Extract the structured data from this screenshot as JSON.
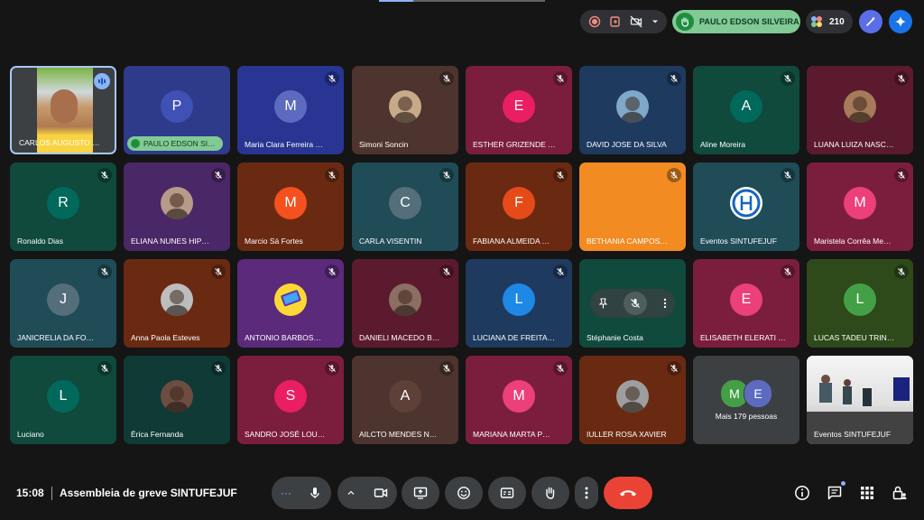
{
  "header": {
    "hand_raised_name": "PAULO EDSON SILVEIRA",
    "participant_count": "210"
  },
  "tiles": [
    {
      "name": "CARLOS AUGUSTO …",
      "initial": "",
      "bg": "#3c4043",
      "avatar_bg": "#bfa35a",
      "photo": true,
      "speaking": true,
      "muted": false
    },
    {
      "name": "PAULO EDSON SI…",
      "initial": "P",
      "bg": "#2e3a8a",
      "avatar_bg": "#3f51b5",
      "hand": true,
      "muted": false
    },
    {
      "name": "Maria Clara Ferreira …",
      "initial": "M",
      "bg": "#283593",
      "avatar_bg": "#5c6bc0",
      "muted": true
    },
    {
      "name": "Simoni Soncin",
      "initial": "",
      "bg": "#4e342e",
      "avatar_bg": "#c8a98a",
      "photo": true,
      "muted": true
    },
    {
      "name": "ESTHER GRIZENDE …",
      "initial": "E",
      "bg": "#7b1e3d",
      "avatar_bg": "#e91e63",
      "muted": true
    },
    {
      "name": "DAVID JOSE DA SILVA",
      "initial": "",
      "bg": "#1e3a5f",
      "avatar_bg": "#7fa8c9",
      "photo": true,
      "muted": true
    },
    {
      "name": "Aline Moreira",
      "initial": "A",
      "bg": "#0f4a3c",
      "avatar_bg": "#00695c",
      "muted": true
    },
    {
      "name": "LUANA LUIZA NASC…",
      "initial": "",
      "bg": "#5c1a2e",
      "avatar_bg": "#a57b5a",
      "photo": true,
      "muted": true
    },
    {
      "name": "Ronaldo Dias",
      "initial": "R",
      "bg": "#0f4a3c",
      "avatar_bg": "#00695c",
      "muted": true
    },
    {
      "name": "ELIANA NUNES HIP…",
      "initial": "",
      "bg": "#4a2766",
      "avatar_bg": "#b89a8a",
      "photo": true,
      "muted": true
    },
    {
      "name": "Marcio Sá Fortes",
      "initial": "M",
      "bg": "#6a2a12",
      "avatar_bg": "#f4511e",
      "muted": true
    },
    {
      "name": "CARLA VISENTIN",
      "initial": "C",
      "bg": "#1f4c57",
      "avatar_bg": "#546e7a",
      "muted": true
    },
    {
      "name": "FABIANA ALMEIDA …",
      "initial": "F",
      "bg": "#6a2a12",
      "avatar_bg": "#e64a19",
      "muted": true
    },
    {
      "name": "BETHANIA CAMPOS…",
      "initial": "",
      "bg": "#f28b22",
      "avatar_bg": "#f28b22",
      "muted": true,
      "noavatar": true
    },
    {
      "name": "Eventos SINTUFEJUF",
      "initial": "",
      "bg": "#1f4c57",
      "avatar_bg": "#ffffff",
      "logo": true,
      "muted": true
    },
    {
      "name": "Maristela Corrêa Me…",
      "initial": "M",
      "bg": "#7b1e3d",
      "avatar_bg": "#ec407a",
      "muted": true
    },
    {
      "name": "JANICRELIA DA FO…",
      "initial": "J",
      "bg": "#1f4c57",
      "avatar_bg": "#546e7a",
      "muted": true
    },
    {
      "name": "Anna Paola Esteves",
      "initial": "",
      "bg": "#6a2a12",
      "avatar_bg": "#bdbdbd",
      "photo": true,
      "muted": true
    },
    {
      "name": "ANTONIO BARBOS…",
      "initial": "",
      "bg": "#5b2a7a",
      "avatar_bg": "#fdd835",
      "phone": true,
      "muted": true
    },
    {
      "name": "DANIELI MACEDO B…",
      "initial": "",
      "bg": "#5c1a2e",
      "avatar_bg": "#8d6e63",
      "photo": true,
      "muted": true
    },
    {
      "name": "LUCIANA DE FREITA…",
      "initial": "L",
      "bg": "#1e3a5f",
      "avatar_bg": "#1e88e5",
      "muted": true
    },
    {
      "name": "Stéphanie Costa",
      "initial": "",
      "bg": "#0f4a3c",
      "avatar_bg": "#0f4a3c",
      "muted": true,
      "hover": true
    },
    {
      "name": "ELISABETH ELERATI …",
      "initial": "E",
      "bg": "#7b1e3d",
      "avatar_bg": "#ec407a",
      "muted": true
    },
    {
      "name": "LUCAS TADEU TRIN…",
      "initial": "L",
      "bg": "#2e4a1a",
      "avatar_bg": "#43a047",
      "muted": true
    },
    {
      "name": "Luciano",
      "initial": "L",
      "bg": "#0f4a3c",
      "avatar_bg": "#00695c",
      "muted": true
    },
    {
      "name": "Érica Fernanda",
      "initial": "",
      "bg": "#0f3a36",
      "avatar_bg": "#6d4c41",
      "photo": true,
      "muted": true
    },
    {
      "name": "SANDRO JOSÉ LOU…",
      "initial": "S",
      "bg": "#7b1e3d",
      "avatar_bg": "#e91e63",
      "muted": true
    },
    {
      "name": "AILCTO MENDES N…",
      "initial": "A",
      "bg": "#4e342e",
      "avatar_bg": "#5d4037",
      "muted": true
    },
    {
      "name": "MARIANA MARTA P…",
      "initial": "M",
      "bg": "#7b1e3d",
      "avatar_bg": "#ec407a",
      "muted": true
    },
    {
      "name": "IULLER ROSA XAVIER",
      "initial": "",
      "bg": "#6a2a12",
      "avatar_bg": "#9e9e9e",
      "photo": true,
      "muted": true
    },
    {
      "name": "Mais 179 pessoas",
      "initial": "",
      "bg": "#3c4043",
      "avatar_bg": "",
      "more": true,
      "more_initials": [
        "M",
        "E"
      ]
    },
    {
      "name": "Eventos SINTUFEJUF",
      "initial": "",
      "bg": "#e0e0e0",
      "avatar_bg": "",
      "room": true
    }
  ],
  "bottom": {
    "time": "15:08",
    "meeting_title": "Assembleia de greve SINTUFEJUF"
  },
  "colors": {
    "background": "#151515",
    "control": "#3c4043",
    "end_call": "#ea4335",
    "hand_pill": "#81c995"
  }
}
